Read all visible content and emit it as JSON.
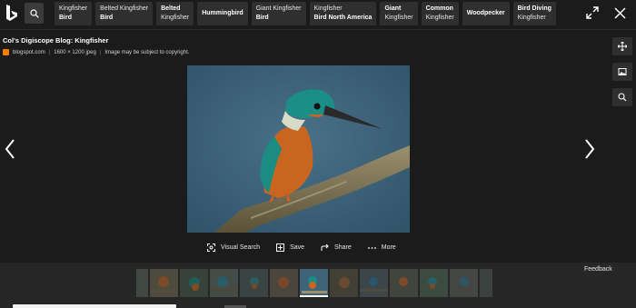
{
  "topbar": {
    "chips": [
      {
        "line1": "Kingfisher",
        "line2": "Bird"
      },
      {
        "line1": "Belted Kingfisher",
        "line2": "Bird"
      },
      {
        "line1": "Belted",
        "line2": "Kingfisher"
      },
      {
        "line1": "Hummingbird",
        "line2": ""
      },
      {
        "line1": "Giant Kingfisher",
        "line2": "Bird"
      },
      {
        "line1": "Kingfisher",
        "line2": "Bird North America"
      },
      {
        "line1": "Giant",
        "line2": "Kingfisher"
      },
      {
        "line1": "Common",
        "line2": "Kingfisher"
      },
      {
        "line1": "Woodpecker",
        "line2": ""
      },
      {
        "line1": "Bird Diving",
        "line2": "Kingfisher"
      }
    ]
  },
  "image_info": {
    "title": "Col's Digiscope Blog: Kingfisher",
    "source": "blogspot.com",
    "dimensions": "1600 × 1200 jpeg",
    "copyright": "Image may be subject to copyright."
  },
  "actions": {
    "visual_search": "Visual Search",
    "save": "Save",
    "share": "Share",
    "more": "More"
  },
  "feedback": "Feedback",
  "colors": {
    "background": "#1b1b1b",
    "chip": "#2f2f2f",
    "source_favicon": "#f57d00"
  },
  "icons": [
    "bing-logo-icon",
    "search-icon",
    "expand-icon",
    "close-icon",
    "chevron-left-icon",
    "chevron-right-icon",
    "move-icon",
    "image-icon",
    "zoom-icon",
    "visual-search-icon",
    "save-icon",
    "share-icon",
    "more-icon"
  ]
}
